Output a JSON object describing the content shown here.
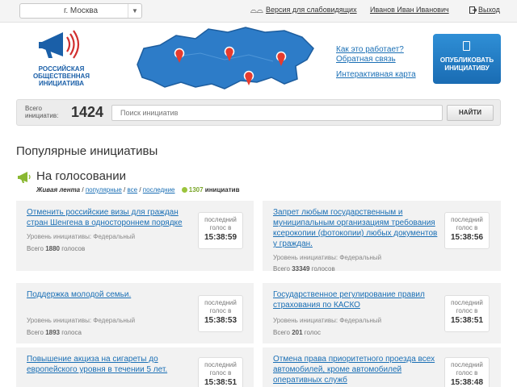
{
  "topbar": {
    "city": "г. Москва",
    "accessibility": "Версия для слабовидящих",
    "user": "Иванов Иван Иванович",
    "logout": "Выход"
  },
  "header": {
    "logo_lines": [
      "РОССИЙСКАЯ",
      "ОБЩЕСТВЕННАЯ",
      "ИНИЦИАТИВА"
    ],
    "links": [
      "Как это работает?",
      "Обратная связь",
      "Интерактивная карта"
    ],
    "publish_lines": [
      "ОПУБЛИКОВАТЬ",
      "ИНИЦИАТИВУ"
    ]
  },
  "search": {
    "total_label_lines": [
      "Всего",
      "инициатив:"
    ],
    "total": "1424",
    "placeholder": "Поиск инициатив",
    "button": "НАЙТИ"
  },
  "page_title": "Популярные инициативы",
  "section": {
    "title": "На голосовании",
    "live": "Живая лента",
    "sep": " / ",
    "filters": [
      "популярные",
      "все",
      "последние"
    ],
    "count": "1307",
    "count_word": "инициатив"
  },
  "card_labels": {
    "last_vote_lines": [
      "последний",
      "голос в"
    ],
    "level_prefix": "Уровень инициативы: ",
    "total_prefix": "Всего ",
    "unit_many": " голосов",
    "unit_few": " голоса",
    "unit_gen": " голос"
  },
  "cards": [
    {
      "title": "Отменить российские визы для граждан стран Шенгена в одностороннем порядке",
      "level": "Федеральный",
      "votes": "1880",
      "unit": " голосов",
      "time": "15:38:59"
    },
    {
      "title": "Запрет любым государственным и муниципальным организациям требования ксерокопии (фотокопии) любых документов у граждан.",
      "level": "Федеральный",
      "votes": "33349",
      "unit": " голосов",
      "time": "15:38:56"
    },
    {
      "title": "Поддержка молодой семьи.",
      "level": "Федеральный",
      "votes": "1893",
      "unit": " голоса",
      "time": "15:38:53"
    },
    {
      "title": "Государственное регулирование правил страхования по КАСКО",
      "level": "Федеральный",
      "votes": "201",
      "unit": " голос",
      "time": "15:38:51"
    },
    {
      "title": "Повышение акциза на сигареты до европейского уровня в течении 5 лет.",
      "level": "",
      "votes": "",
      "unit": "",
      "time": "15:38:51"
    },
    {
      "title": "Отмена права приоритетного проезда всех автомобилей, кроме автомобилей оперативных служб",
      "level": "",
      "votes": "",
      "unit": "",
      "time": "15:38:48"
    }
  ],
  "colors": {
    "brand_blue": "#1a6cb3",
    "link": "#1a6fb5",
    "accent_green": "#9bc43c",
    "map_pin": "#e63b2e"
  }
}
